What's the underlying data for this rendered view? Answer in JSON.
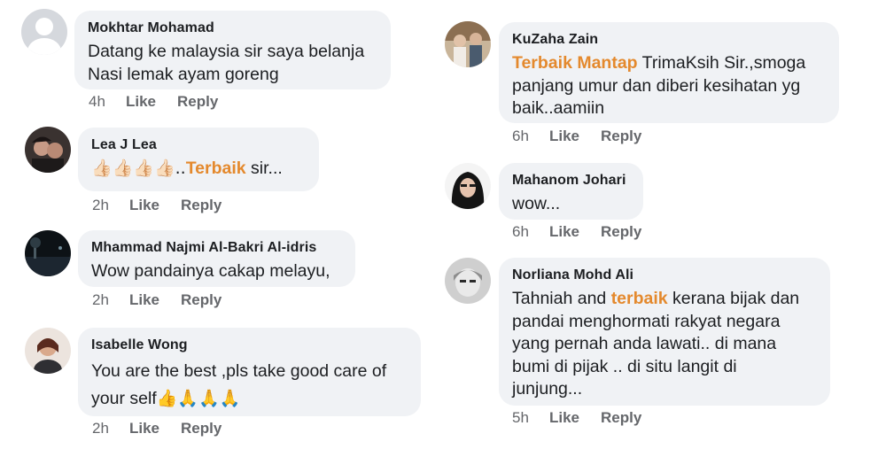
{
  "like_label": "Like",
  "reply_label": "Reply",
  "comments": [
    {
      "name": "Mokhtar Mohamad",
      "line1": "Datang ke malaysia sir saya belanja",
      "line2": "Nasi lemak ayam goreng",
      "time": "4h"
    },
    {
      "name": "Lea J Lea",
      "emoji": "👍🏻👍🏻👍🏻👍🏻..",
      "highlight": "Terbaik",
      "rest": " sir...",
      "time": "2h"
    },
    {
      "name": "Mhammad Najmi Al-Bakri Al-idris",
      "line1": "Wow pandainya cakap melayu,",
      "time": "2h"
    },
    {
      "name": "Isabelle Wong",
      "line1": "You are the best ,pls take good care of",
      "line2": "your self",
      "emoji": "👍🙏🙏🙏",
      "time": "2h"
    },
    {
      "name": "KuZaha Zain",
      "highlight": "Terbaik Mantap",
      "rest": " TrimaKsih Sir.,smoga",
      "line2": "panjang umur dan diberi kesihatan yg",
      "line3": "baik..aamiin",
      "time": "6h"
    },
    {
      "name": "Mahanom Johari",
      "line1": "wow...",
      "time": "6h"
    },
    {
      "name": "Norliana Mohd Ali",
      "pre": "Tahniah and ",
      "highlight": "terbaik",
      "rest": " kerana bijak dan",
      "line2": "pandai menghormati rakyat negara",
      "line3": "yang pernah anda lawati.. di mana",
      "line4": "bumi di pijak .. di situ langit di",
      "line5": "junjung...",
      "time": "5h"
    }
  ],
  "colors": {
    "bubble": "#f0f2f5",
    "highlight": "#e4892d",
    "meta": "#65676b"
  }
}
